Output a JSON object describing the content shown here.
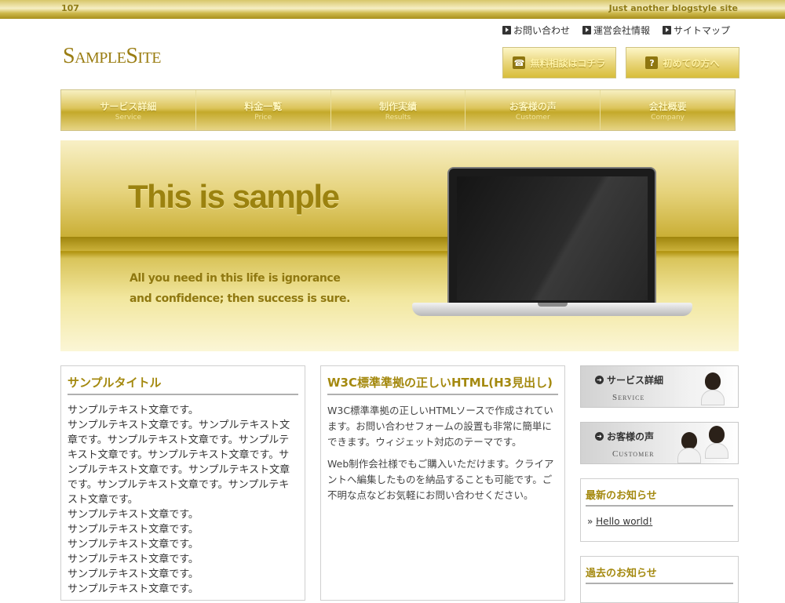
{
  "topbar": {
    "number": "107",
    "tagline": "Just another blogstyle site"
  },
  "toplinks": [
    {
      "label": "お問い合わせ"
    },
    {
      "label": "運営会社情報"
    },
    {
      "label": "サイトマップ"
    }
  ],
  "logo": "SampleSite",
  "header_buttons": [
    {
      "label": "無料相談はコチラ",
      "icon": "phone-icon",
      "glyph": "☎"
    },
    {
      "label": "初めての方へ",
      "icon": "question-icon",
      "glyph": "?"
    }
  ],
  "nav": [
    {
      "jp": "サービス詳細",
      "en": "Service"
    },
    {
      "jp": "料金一覧",
      "en": "Price"
    },
    {
      "jp": "制作実績",
      "en": "Results"
    },
    {
      "jp": "お客様の声",
      "en": "Customer"
    },
    {
      "jp": "会社概要",
      "en": "Company"
    }
  ],
  "hero": {
    "title": "This is sample",
    "subtitle": "All you need in this life is ignorance and confidence; then success is sure."
  },
  "col1": {
    "title": "サンプルタイトル",
    "lines": [
      "サンプルテキスト文章です。",
      "サンプルテキスト文章です。サンプルテキスト文章です。サンプルテキスト文章です。サンプルテキスト文章です。サンプルテキスト文章です。サンプルテキスト文章です。サンプルテキスト文章です。サンプルテキスト文章です。サンプルテキスト文章です。",
      "サンプルテキスト文章です。",
      "サンプルテキスト文章です。",
      "サンプルテキスト文章です。",
      "サンプルテキスト文章です。",
      "サンプルテキスト文章です。",
      "サンプルテキスト文章です。"
    ]
  },
  "col2": {
    "title": "W3C標準準拠の正しいHTML(H3見出し)",
    "p1": "W3C標準準拠の正しいHTMLソースで作成されています。お問い合わせフォームの設置も非常に簡単にできます。ウィジェット対応のテーマです。",
    "p2": "Web制作会社様でもご購入いただけます。クライアントへ編集したものを納品することも可能です。ご不明な点などお気軽にお問い合わせください。"
  },
  "side_banners": [
    {
      "jp": "サービス詳細",
      "en": "Service"
    },
    {
      "jp": "お客様の声",
      "en": "Customer"
    }
  ],
  "news": {
    "title": "最新のお知らせ",
    "item": "Hello world!"
  },
  "past_news": {
    "title": "過去のお知らせ"
  }
}
